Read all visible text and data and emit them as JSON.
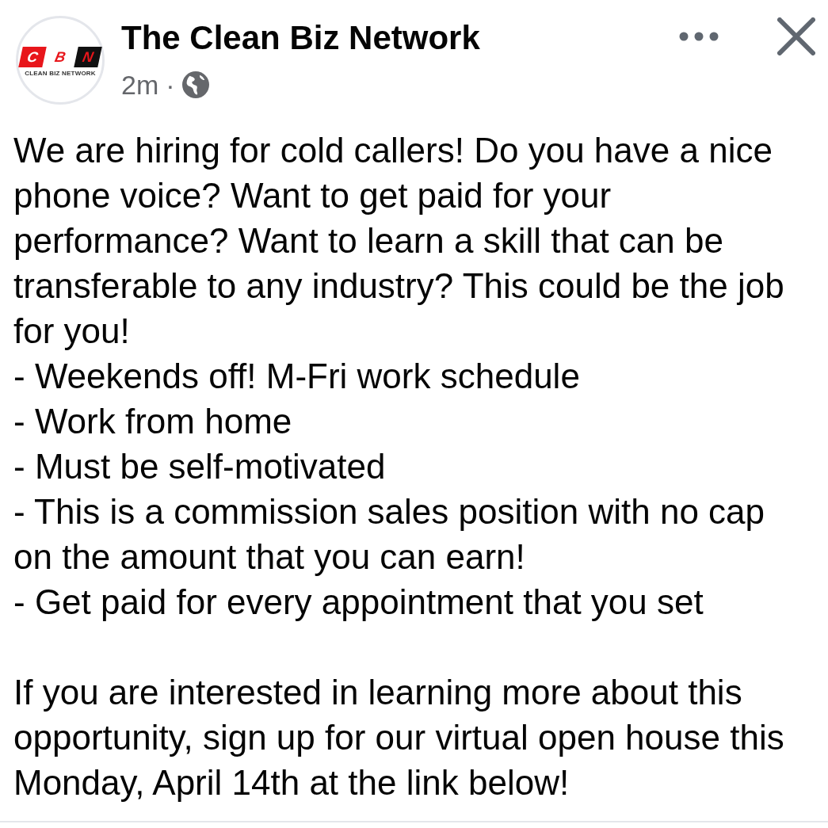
{
  "post": {
    "author": "The Clean Biz Network",
    "time": "2m",
    "separator": "·",
    "avatar": {
      "tiles": [
        {
          "letter": "C",
          "kind": "red"
        },
        {
          "letter": "B",
          "kind": "light"
        },
        {
          "letter": "N",
          "kind": "dark"
        }
      ],
      "caption": "CLEAN BIZ NETWORK"
    }
  },
  "body": {
    "intro": "We are hiring for cold callers! Do you have a nice\nphone voice? Want to get paid for your\nperformance? Want to learn a skill that can be\ntransferable to any industry? This could be the job\nfor you!",
    "bullets": [
      "- Weekends off! M-Fri work schedule",
      "- Work from home",
      "- Must be self-motivated",
      "- This is a commission sales position with no cap\non the amount that you can earn!",
      "- Get paid for every appointment that you set"
    ],
    "closing": "If you are interested in learning more about this\nopportunity, sign up for our virtual open house this\nMonday, April 14th at the link below!"
  }
}
